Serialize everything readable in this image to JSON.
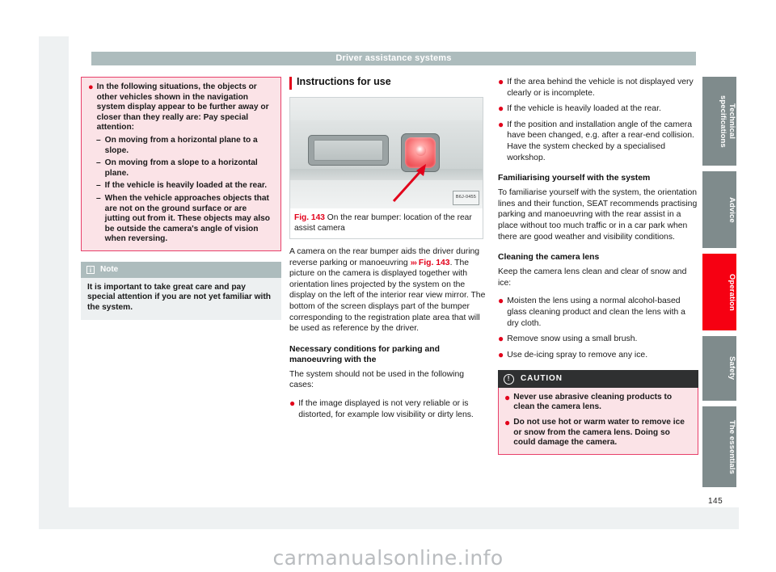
{
  "document": {
    "header_title": "Driver assistance systems",
    "page_number": "145",
    "watermark": "carmanualsonline.info"
  },
  "left_column": {
    "warning_box": {
      "lead_bullet": "In the following situations, the objects or other vehicles shown in the navigation system display appear to be further away or closer than they really are: Pay special attention:",
      "sub_items": [
        "On moving from a horizontal plane to a slope.",
        "On moving from a slope to a horizontal plane.",
        "If the vehicle is heavily loaded at the rear.",
        "When the vehicle approaches objects that are not on the ground surface or are jutting out from it. These objects may also be outside the camera's angle of vision when reversing."
      ]
    },
    "note_box": {
      "icon": "info-icon",
      "title": "Note",
      "text": "It is important to take great care and pay special attention if you are not yet familiar with the system."
    }
  },
  "center_column": {
    "section_heading": "Instructions for use",
    "figure": {
      "image_code": "B6J-0455",
      "label": "Fig. 143",
      "caption": "On the rear bumper: location of the rear assist camera"
    },
    "intro_paragraph_1": "A camera on the rear bumper aids the driver during reverse parking or manoeuvring ",
    "intro_ref_arrows": "›››",
    "intro_ref_label": "Fig. 143",
    "intro_paragraph_2": ". The picture on the camera is displayed together with orientation lines projected by the system on the display on the left of the interior rear view mirror. The bottom of the screen displays part of the bumper corresponding to the registration plate area that will be used as reference by the driver.",
    "conditions_heading": "Necessary conditions for parking and manoeuvring with the",
    "conditions_intro": "The system should not be used in the following cases:",
    "conditions_bullets": [
      "If the image displayed is not very reliable or is distorted, for example low visibility or dirty lens."
    ]
  },
  "right_column": {
    "conditions_bullets": [
      "If the area behind the vehicle is not displayed very clearly or is incomplete.",
      "If the vehicle is heavily loaded at the rear.",
      "If the position and installation angle of the camera have been changed, e.g. after a rear-end collision. Have the system checked by a specialised workshop."
    ],
    "familiarising_heading": "Familiarising yourself with the system",
    "familiarising_text": "To familiarise yourself with the system, the orientation lines and their function, SEAT recommends practising parking and manoeuvring with the rear assist in a place without too much traffic or in a car park when there are good weather and visibility conditions.",
    "cleaning_heading": "Cleaning the camera lens",
    "cleaning_intro": "Keep the camera lens clean and clear of snow and ice:",
    "cleaning_bullets": [
      "Moisten the lens using a normal alcohol-based glass cleaning product and clean the lens with a dry cloth.",
      "Remove snow using a small brush.",
      "Use de-icing spray to remove any ice."
    ],
    "caution_box": {
      "icon": "warning-circle-icon",
      "title": "CAUTION",
      "bullets": [
        "Never use abrasive cleaning products to clean the camera lens.",
        "Do not use hot or warm water to remove ice or snow from the camera lens. Doing so could damage the camera."
      ]
    }
  },
  "side_tabs": {
    "items": [
      {
        "label": "Technical specifications",
        "active": false
      },
      {
        "label": "Advice",
        "active": false
      },
      {
        "label": "Operation",
        "active": true
      },
      {
        "label": "Safety",
        "active": false
      },
      {
        "label": "The essentials",
        "active": false
      }
    ]
  },
  "colors": {
    "accent_red": "#e2001a",
    "active_tab_red": "#f60012",
    "header_grey": "#adbcbd",
    "pink_bg": "#fbe3e7",
    "pink_border": "#e8406a",
    "tab_grey": "#7f8b8c",
    "caution_header": "#2f3031"
  }
}
